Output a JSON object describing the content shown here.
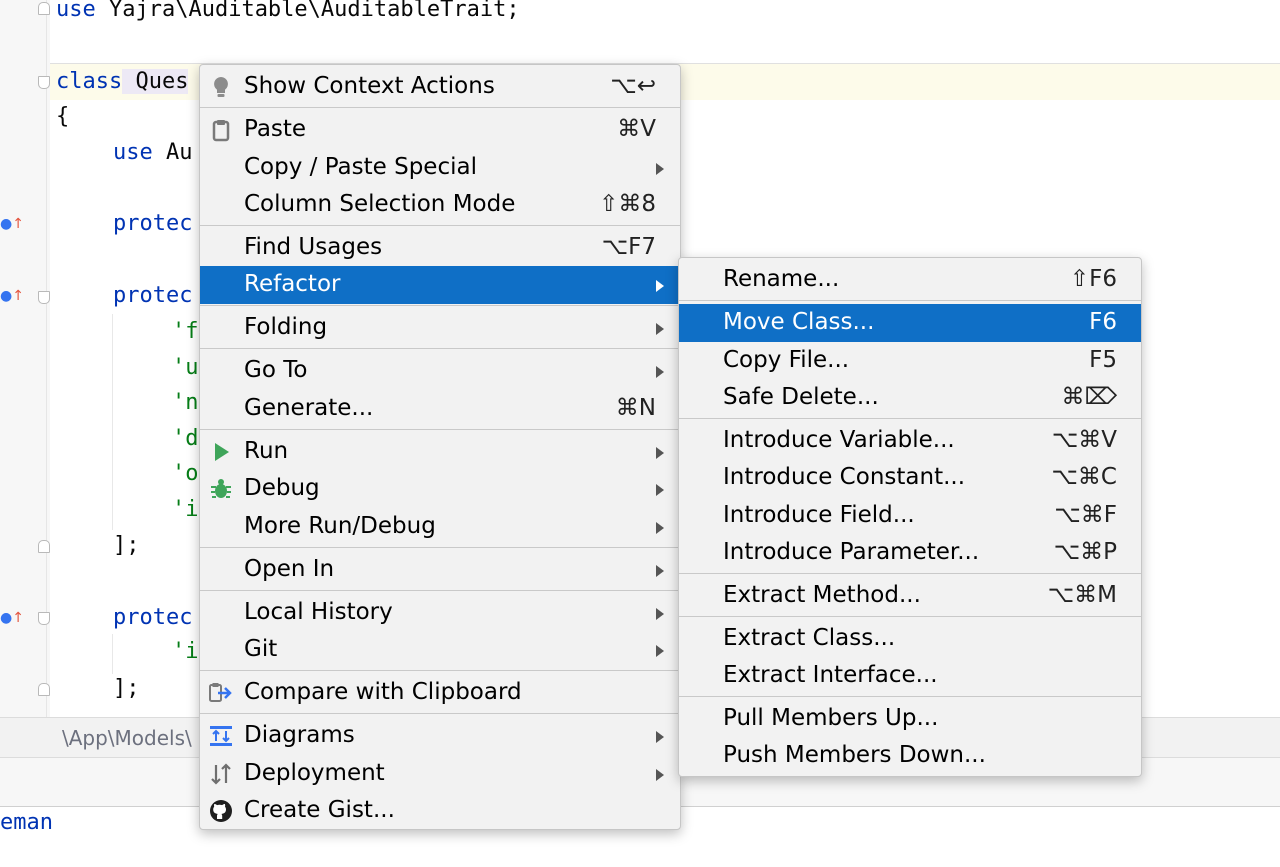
{
  "editor": {
    "lines": {
      "use_kw": "use",
      "use_ns": " Yajra\\Auditable\\AuditableTrait;",
      "class_kw": "class",
      "class_name": " Ques",
      "brace_open": "{",
      "use2_kw": "use",
      "use2_rest": " Au",
      "protec1": "protec",
      "protec2": "protec",
      "str_f": "'f",
      "str_u": "'u",
      "str_n": "'n",
      "str_d": "'d",
      "str_o": "'o",
      "str_i": "'i",
      "close1": "];",
      "protec3": "protec",
      "str_i2": "'i",
      "close2": "];"
    }
  },
  "breadcrumb": {
    "path": "\\App\\Models\\"
  },
  "bottom": {
    "text": "eman"
  },
  "context_menu": {
    "items": [
      {
        "label": "Show Context Actions",
        "shortcut": "⌥↩"
      },
      {
        "label": "Paste",
        "shortcut": "⌘V"
      },
      {
        "label": "Copy / Paste Special",
        "shortcut": ""
      },
      {
        "label": "Column Selection Mode",
        "shortcut": "⇧⌘8"
      },
      {
        "label": "Find Usages",
        "shortcut": "⌥F7"
      },
      {
        "label": "Refactor",
        "shortcut": ""
      },
      {
        "label": "Folding",
        "shortcut": ""
      },
      {
        "label": "Go To",
        "shortcut": ""
      },
      {
        "label": "Generate...",
        "shortcut": "⌘N"
      },
      {
        "label": "Run",
        "shortcut": ""
      },
      {
        "label": "Debug",
        "shortcut": ""
      },
      {
        "label": "More Run/Debug",
        "shortcut": ""
      },
      {
        "label": "Open In",
        "shortcut": ""
      },
      {
        "label": "Local History",
        "shortcut": ""
      },
      {
        "label": "Git",
        "shortcut": ""
      },
      {
        "label": "Compare with Clipboard",
        "shortcut": ""
      },
      {
        "label": "Diagrams",
        "shortcut": ""
      },
      {
        "label": "Deployment",
        "shortcut": ""
      },
      {
        "label": "Create Gist...",
        "shortcut": ""
      }
    ]
  },
  "refactor_menu": {
    "items": [
      {
        "label": "Rename...",
        "shortcut": "⇧F6"
      },
      {
        "label": "Move Class...",
        "shortcut": "F6"
      },
      {
        "label": "Copy File...",
        "shortcut": "F5"
      },
      {
        "label": "Safe Delete...",
        "shortcut": "⌘⌦"
      },
      {
        "label": "Introduce Variable...",
        "shortcut": "⌥⌘V"
      },
      {
        "label": "Introduce Constant...",
        "shortcut": "⌥⌘C"
      },
      {
        "label": "Introduce Field...",
        "shortcut": "⌥⌘F"
      },
      {
        "label": "Introduce Parameter...",
        "shortcut": "⌥⌘P"
      },
      {
        "label": "Extract Method...",
        "shortcut": "⌥⌘M"
      },
      {
        "label": "Extract Class...",
        "shortcut": ""
      },
      {
        "label": "Extract Interface...",
        "shortcut": ""
      },
      {
        "label": "Pull Members Up...",
        "shortcut": ""
      },
      {
        "label": "Push Members Down...",
        "shortcut": ""
      }
    ]
  },
  "colors": {
    "selection": "#0f6fc6",
    "keyword": "#0033b3",
    "string": "#067d17",
    "menu_bg": "#f2f2f2"
  }
}
